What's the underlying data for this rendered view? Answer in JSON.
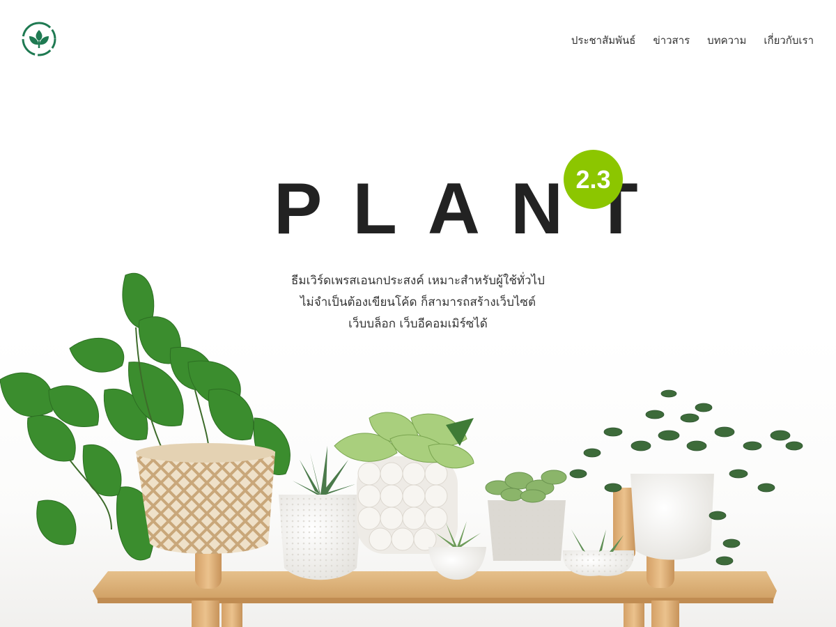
{
  "header": {
    "logo_icon": "leaf-logo-icon",
    "nav": [
      {
        "label": "ประชาสัมพันธ์"
      },
      {
        "label": "ข่าวสาร"
      },
      {
        "label": "บทความ"
      },
      {
        "label": "เกี่ยวกับเรา"
      }
    ]
  },
  "hero": {
    "title": "PLANT",
    "version_badge": "2.3",
    "tagline": [
      "ธีมเวิร์ดเพรสเอนกประสงค์ เหมาะสำหรับผู้ใช้ทั่วไป",
      "ไม่จำเป็นต้องเขียนโค้ด ก็สามารถสร้างเว็บไซต์",
      "เว็บบล็อก เว็บอีคอมเมิร์ซได้"
    ]
  },
  "colors": {
    "brand_green": "#1f7a52",
    "badge_green": "#8cc600",
    "text_dark": "#222222"
  }
}
